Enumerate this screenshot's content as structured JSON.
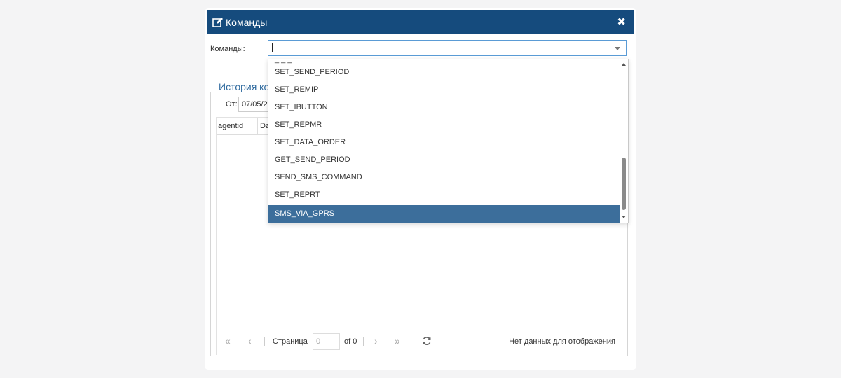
{
  "dialog": {
    "title": "Команды",
    "close_icon": "close-icon",
    "title_icon": "edit-icon"
  },
  "commands": {
    "label": "Команды:",
    "value": ""
  },
  "history": {
    "legend": "История ко",
    "from_label": "От:",
    "from_value": "07/05/2",
    "columns": [
      "agentid",
      "Da"
    ]
  },
  "pager": {
    "page_label": "Страница",
    "page_value": "0",
    "of_label": "of 0",
    "status": "Нет данных для отображения"
  },
  "dropdown": {
    "partial_item": "_ _ _",
    "items": [
      "SET_SEND_PERIOD",
      "SET_REMIP",
      "SET_IBUTTON",
      "SET_REPMR",
      "SET_DATA_ORDER",
      "GET_SEND_PERIOD",
      "SEND_SMS_COMMAND",
      "SET_REPRT",
      "SMS_VIA_GPRS"
    ],
    "selected": "SMS_VIA_GPRS"
  },
  "colors": {
    "titlebar": "#154b7d",
    "selected_item": "#3c6e9b",
    "legend_text": "#2f6a9f"
  }
}
